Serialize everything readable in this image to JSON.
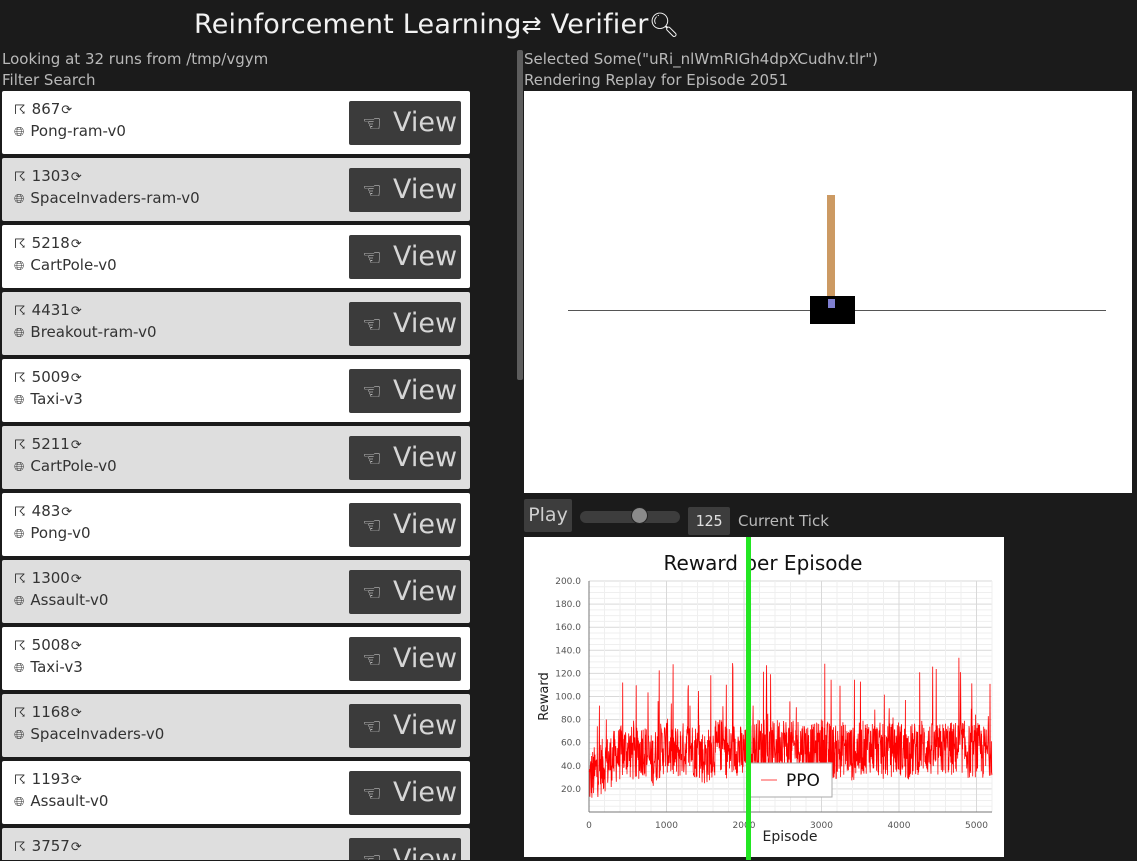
{
  "app": {
    "title": "Reinforcement Learning",
    "title_icons": [
      "arrows-exchange-icon",
      "magnifier-icon"
    ],
    "title_rest": "Verifier",
    "runs_summary": "Looking at 32 runs from /tmp/vgym",
    "filter_label": "Filter Search"
  },
  "runs": [
    {
      "id": "867",
      "env": "Pong-ram-v0"
    },
    {
      "id": "1303",
      "env": "SpaceInvaders-ram-v0"
    },
    {
      "id": "5218",
      "env": "CartPole-v0"
    },
    {
      "id": "4431",
      "env": "Breakout-ram-v0"
    },
    {
      "id": "5009",
      "env": "Taxi-v3"
    },
    {
      "id": "5211",
      "env": "CartPole-v0"
    },
    {
      "id": "483",
      "env": "Pong-v0"
    },
    {
      "id": "1300",
      "env": "Assault-v0"
    },
    {
      "id": "5008",
      "env": "Taxi-v3"
    },
    {
      "id": "1168",
      "env": "SpaceInvaders-v0"
    },
    {
      "id": "1193",
      "env": "Assault-v0"
    },
    {
      "id": "3757",
      "env": ""
    }
  ],
  "view_label": "View",
  "selection": {
    "selected_text": "Selected Some(\"uRi_nlWmRIGh4dpXCudhv.tlr\")",
    "rendering_text": "Rendering Replay for Episode 2051"
  },
  "playback": {
    "play_label": "Play",
    "tick_value": "125",
    "tick_label": "Current Tick",
    "slider_fraction": 0.6
  },
  "colors": {
    "series": "#ff0000",
    "marker": "#22e622",
    "row_white": "#ffffff",
    "row_gray": "#dedede"
  },
  "chart_data": {
    "type": "line",
    "title": "Reward per Episode",
    "xlabel": "Episode",
    "ylabel": "Reward",
    "xlim": [
      0,
      5200
    ],
    "ylim": [
      0,
      200
    ],
    "x_ticks": [
      "0",
      "1000",
      "2000",
      "3000",
      "4000",
      "5000"
    ],
    "y_ticks": [
      "20.0",
      "40.0",
      "60.0",
      "80.0",
      "100.0",
      "120.0",
      "140.0",
      "160.0",
      "180.0",
      "200.0"
    ],
    "grid": true,
    "legend": "bottom-center",
    "marker_episode": 2051,
    "series": [
      {
        "name": "PPO",
        "color": "#ff0000",
        "x": [
          0,
          100,
          200,
          300,
          400,
          500,
          600,
          700,
          800,
          900,
          1000,
          1100,
          1200,
          1300,
          1400,
          1500,
          1600,
          1700,
          1800,
          1900,
          2000,
          2100,
          2200,
          2300,
          2400,
          2500,
          2600,
          2700,
          2800,
          2900,
          3000,
          3100,
          3200,
          3300,
          3400,
          3500,
          3600,
          3700,
          3800,
          3900,
          4000,
          4100,
          4200,
          4300,
          4400,
          4500,
          4600,
          4700,
          4800,
          4900,
          5000,
          5100,
          5200
        ],
        "y": [
          32,
          40,
          45,
          50,
          55,
          58,
          52,
          60,
          48,
          56,
          62,
          54,
          58,
          60,
          56,
          50,
          58,
          62,
          55,
          60,
          52,
          58,
          62,
          55,
          60,
          65,
          58,
          62,
          60,
          56,
          62,
          58,
          55,
          60,
          54,
          58,
          62,
          60,
          56,
          58,
          60,
          55,
          58,
          62,
          58,
          56,
          60,
          58,
          62,
          56,
          58,
          55,
          60
        ]
      }
    ]
  }
}
